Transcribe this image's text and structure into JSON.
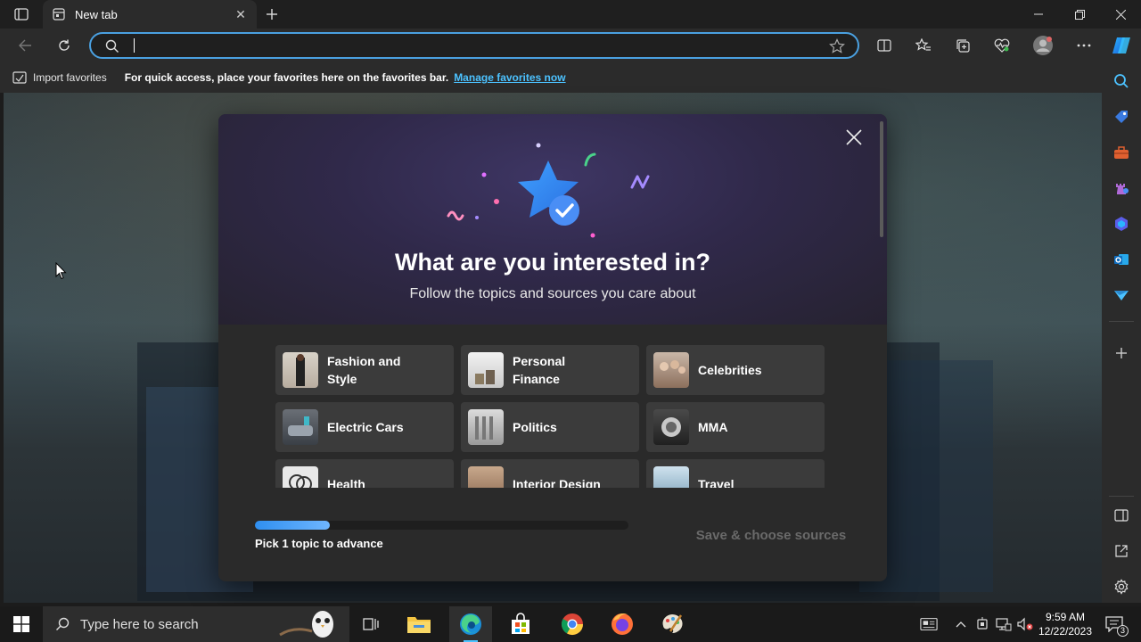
{
  "browser": {
    "tab_title": "New tab",
    "address_value": "",
    "address_placeholder": ""
  },
  "favorites_bar": {
    "import_label": "Import favorites",
    "message": "For quick access, place your favorites here on the favorites bar.",
    "manage_link": "Manage favorites now"
  },
  "modal": {
    "title": "What are you interested in?",
    "subtitle": "Follow the topics and sources you care about",
    "topics": [
      {
        "label": "Fashion and Style"
      },
      {
        "label": "Personal Finance"
      },
      {
        "label": "Celebrities"
      },
      {
        "label": "Electric Cars"
      },
      {
        "label": "Politics"
      },
      {
        "label": "MMA"
      },
      {
        "label": "Health"
      },
      {
        "label": "Interior Design"
      },
      {
        "label": "Travel"
      }
    ],
    "progress": 0.2,
    "progress_label": "Pick 1 topic to advance",
    "save_button": "Save & choose sources"
  },
  "taskbar": {
    "search_placeholder": "Type here to search",
    "time": "9:59 AM",
    "date": "12/22/2023",
    "notification_count": "3"
  },
  "colors": {
    "accent": "#4cc2ff",
    "address_border": "#4aa0e0",
    "progress": "#2f8ff0"
  },
  "icons": {
    "sidebar": [
      "search-icon",
      "tag-icon",
      "toolbox-icon",
      "chess-icon",
      "copilot-icon",
      "outlook-icon",
      "send-icon",
      "add-icon",
      "sidebar-toggle-icon",
      "external-link-icon",
      "settings-icon"
    ]
  }
}
